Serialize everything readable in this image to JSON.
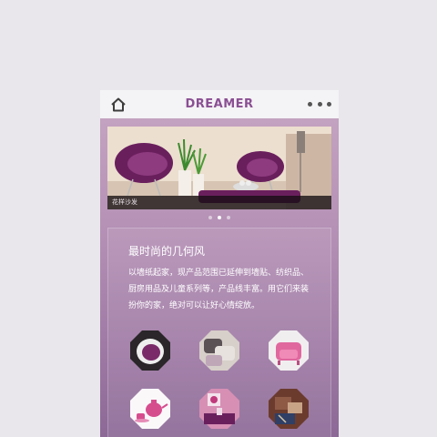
{
  "header": {
    "title": "DREAMER",
    "home_icon": "home-icon",
    "more_icon": "more-dots-icon"
  },
  "banner": {
    "caption": "花样沙发",
    "dots_total": 3,
    "dots_active_index": 1
  },
  "card": {
    "title": "最时尚的几何风",
    "body": "以墙纸起家，现产品范围已延伸到墙贴、纺织品、厨房用品及儿童系列等，产品线丰富。用它们来装扮你的家，绝对可以让好心情绽放。"
  },
  "tiles": [
    {
      "name": "egg-chair"
    },
    {
      "name": "pillows"
    },
    {
      "name": "pink-armchair"
    },
    {
      "name": "teapot-set"
    },
    {
      "name": "flower-vase"
    },
    {
      "name": "gift-box"
    }
  ],
  "colors": {
    "accent": "#8a4f93",
    "header_bg": "#f4f3f5",
    "page_bg": "#e9e7ec"
  }
}
